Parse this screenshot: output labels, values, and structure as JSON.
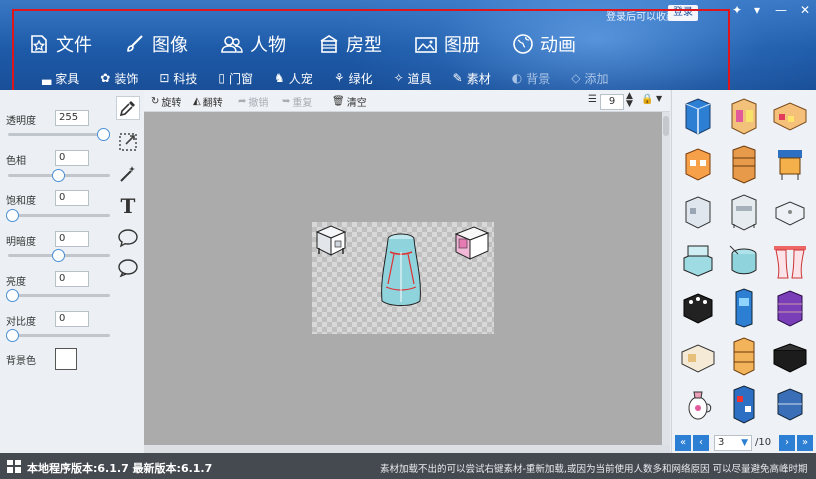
{
  "header": {
    "login_hint": "登录后可以收藏",
    "login_button": "登录",
    "main_nav": [
      {
        "label": "文件",
        "icon": "star-doc-icon"
      },
      {
        "label": "图像",
        "icon": "brush-icon"
      },
      {
        "label": "人物",
        "icon": "people-icon"
      },
      {
        "label": "房型",
        "icon": "building-icon"
      },
      {
        "label": "图册",
        "icon": "photo-album-icon"
      },
      {
        "label": "动画",
        "icon": "globe-icon"
      }
    ],
    "sub_nav": [
      {
        "label": "家具",
        "icon": "sofa-icon"
      },
      {
        "label": "装饰",
        "icon": "decor-icon"
      },
      {
        "label": "科技",
        "icon": "tech-icon"
      },
      {
        "label": "门窗",
        "icon": "door-icon"
      },
      {
        "label": "人宠",
        "icon": "pet-icon"
      },
      {
        "label": "绿化",
        "icon": "plant-icon"
      },
      {
        "label": "道具",
        "icon": "prop-icon"
      },
      {
        "label": "素材",
        "icon": "material-icon"
      },
      {
        "label": "背景",
        "icon": "background-icon"
      },
      {
        "label": "添加",
        "icon": "add-icon"
      }
    ]
  },
  "properties": {
    "opacity": {
      "label": "透明度",
      "value": "255",
      "level": 1.0
    },
    "hue": {
      "label": "色相",
      "value": "0",
      "level": 0.5
    },
    "saturation": {
      "label": "饱和度",
      "value": "0",
      "level": 0.0
    },
    "shade": {
      "label": "明暗度",
      "value": "0",
      "level": 0.5
    },
    "brightness": {
      "label": "亮度",
      "value": "0",
      "level": 0.0
    },
    "contrast": {
      "label": "对比度",
      "value": "0",
      "level": 0.0
    },
    "background_color_label": "背景色"
  },
  "canvas_toolbar": {
    "rotate": "旋转",
    "flip": "翻转",
    "undo": "撤销",
    "redo": "重复",
    "clear": "清空",
    "layer_value": "9"
  },
  "gallery": {
    "current_page": "3",
    "total_pages": "/10"
  },
  "status": {
    "version": "本地程序版本:6.1.7  最新版本:6.1.7",
    "message": "素材加载不出的可以尝试右键素材-重新加载,或因为当前使用人数多和网络原因  可以尽量避免高峰时期"
  },
  "colors": {
    "header": "#1d5aa8",
    "highlight_frame": "#e0141b",
    "canvas_bg": "#ababab",
    "status_bar": "#454a50",
    "accent": "#2d7fd3"
  }
}
